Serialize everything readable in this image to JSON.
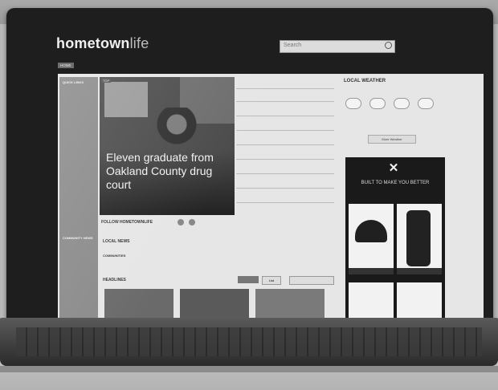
{
  "site": {
    "logo_main": "hometown",
    "logo_light": "life",
    "search_placeholder": "Search",
    "nav_home": "HOME"
  },
  "hero": {
    "headline": "Eleven graduate from Oakland County drug court",
    "badge": "TOP"
  },
  "sidebar": {
    "title": "QUICK LINKS",
    "community": "COMMUNITY NEWS"
  },
  "weather": {
    "title": "LOCAL WEATHER",
    "more": "More Weather"
  },
  "ad": {
    "tagline": "BUILT TO MAKE YOU BETTER"
  },
  "follow": {
    "label": "FOLLOW HOMETOWNLIFE"
  },
  "local_news": {
    "title": "LOCAL NEWS",
    "communities_label": "COMMUNITIES"
  },
  "headlines": {
    "title": "HEADLINES",
    "list_label": "List"
  }
}
